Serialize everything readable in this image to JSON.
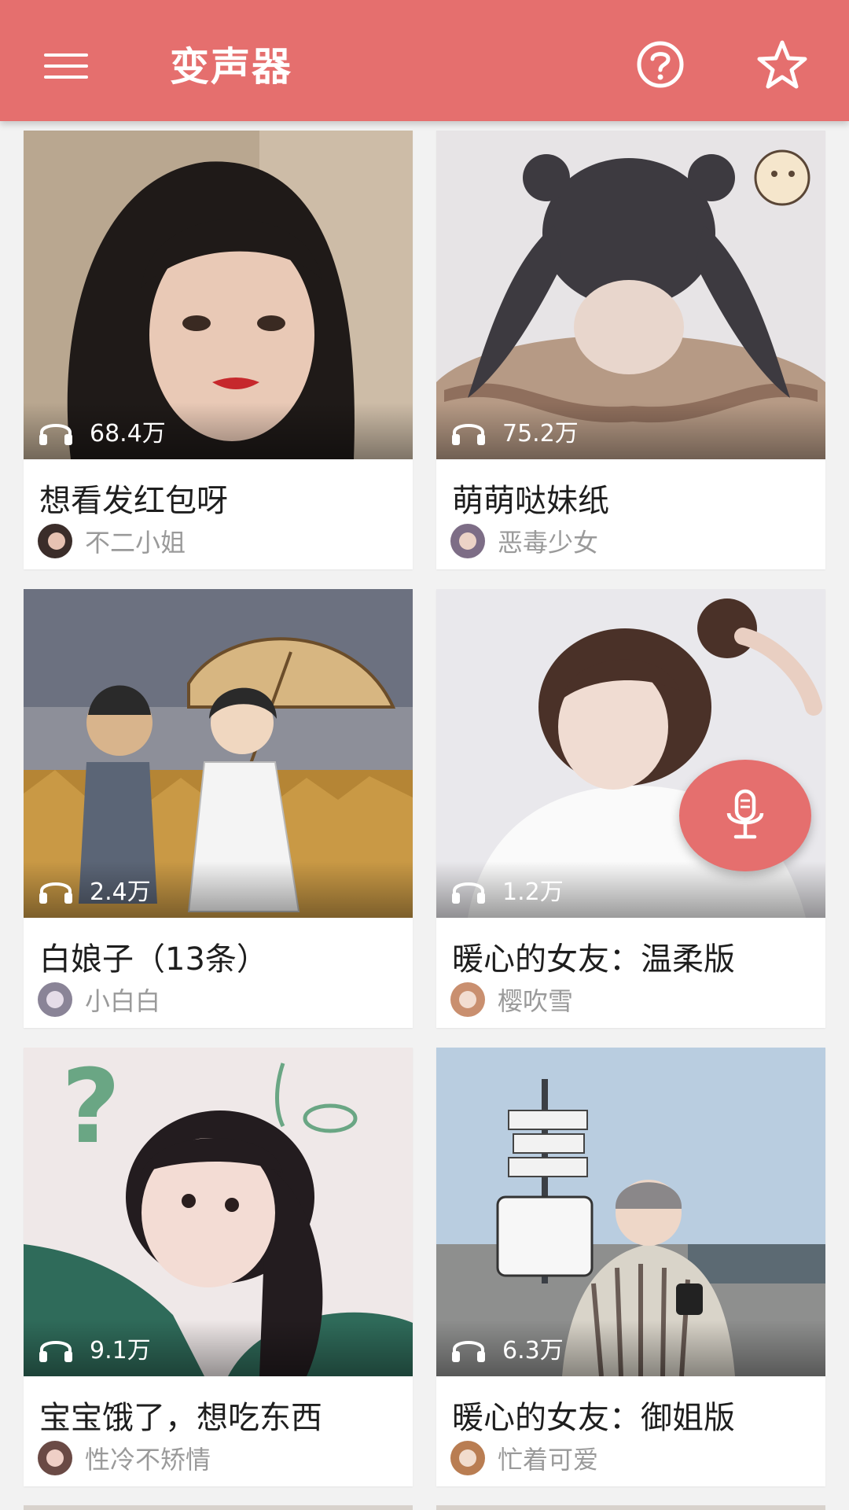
{
  "appbar": {
    "title": "变声器",
    "menu_icon": "hamburger-menu-icon",
    "help_icon": "help-circle-icon",
    "favorite_icon": "star-outline-icon",
    "color": "#e56f6e"
  },
  "cards": [
    {
      "plays": "68.4万",
      "title": "想看发红包呀",
      "author": "不二小姐"
    },
    {
      "plays": "75.2万",
      "title": "萌萌哒妹纸",
      "author": "恶毒少女"
    },
    {
      "plays": "2.4万",
      "title": "白娘子（13条）",
      "author": "小白白"
    },
    {
      "plays": "1.2万",
      "title": "暖心的女友：温柔版",
      "author": "樱吹雪"
    },
    {
      "plays": "9.1万",
      "title": "宝宝饿了，想吃东西",
      "author": "性冷不矫情"
    },
    {
      "plays": "6.3万",
      "title": "暖心的女友：御姐版",
      "author": "忙着可爱"
    }
  ],
  "fab": {
    "icon": "microphone-icon"
  }
}
